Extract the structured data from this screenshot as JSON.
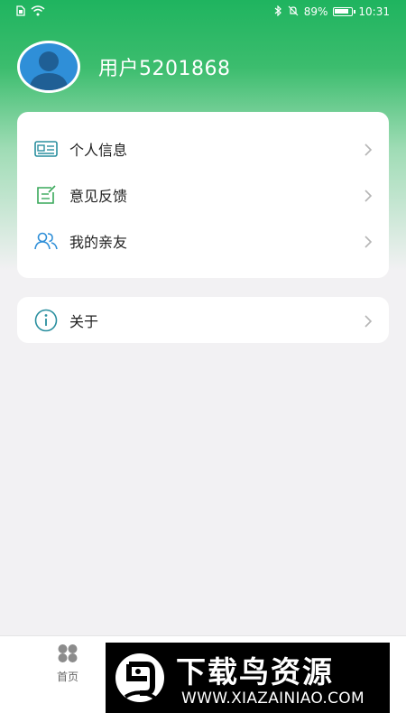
{
  "status_bar": {
    "battery_percent": "89%",
    "time": "10:31"
  },
  "profile": {
    "username": "用户5201868"
  },
  "menu": {
    "items": [
      {
        "label": "个人信息",
        "icon": "id-card-icon"
      },
      {
        "label": "意见反馈",
        "icon": "feedback-edit-icon"
      },
      {
        "label": "我的亲友",
        "icon": "people-icon"
      }
    ],
    "about": {
      "label": "关于",
      "icon": "info-icon"
    }
  },
  "tabbar": {
    "home_label": "首页"
  },
  "watermark": {
    "title": "下载鸟资源",
    "url": "WWW.XIAZAINIAO.COM"
  },
  "colors": {
    "brand_green": "#1fb45f",
    "icon_teal": "#2a8f9f",
    "icon_green": "#39a85a",
    "icon_blue": "#2f8fd8",
    "background": "#f2f1f3"
  }
}
